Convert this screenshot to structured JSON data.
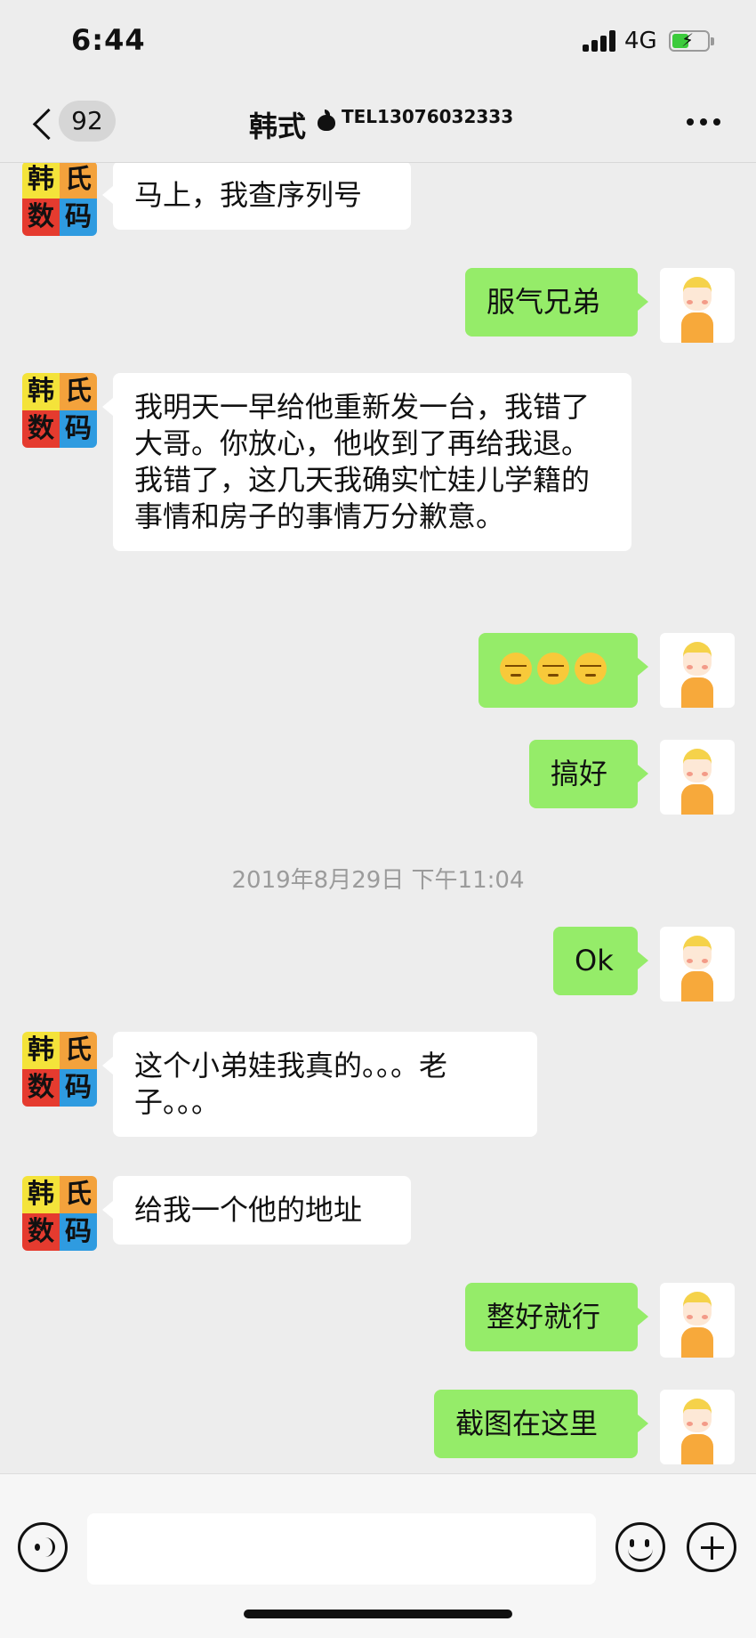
{
  "status_bar": {
    "time": "6:44",
    "network": "4G"
  },
  "nav": {
    "back_badge": "92",
    "title": "韩式",
    "subtitle": "TEL13076032333"
  },
  "shop_avatar": {
    "chars": [
      "韩",
      "氏",
      "数",
      "码"
    ]
  },
  "messages": [
    {
      "side": "in",
      "text": "马上，我查序列号"
    },
    {
      "side": "out",
      "text": "服气兄弟"
    },
    {
      "side": "in",
      "text": "我明天一早给他重新发一台，我错了大哥。你放心，他收到了再给我退。我错了，这几天我确实忙娃儿学籍的事情和房子的事情万分歉意。"
    },
    {
      "side": "out",
      "emoji": [
        "sweat-smile-icon",
        "sweat-smile-icon",
        "sweat-smile-icon"
      ]
    },
    {
      "side": "out",
      "text": "搞好"
    },
    {
      "side": "out",
      "text": "Ok"
    },
    {
      "side": "in",
      "text": "这个小弟娃我真的。。。老子。。。"
    },
    {
      "side": "in",
      "text": "给我一个他的地址"
    },
    {
      "side": "out",
      "text": "整好就行"
    },
    {
      "side": "out",
      "text": "截图在这里"
    }
  ],
  "timestamp": "2019年8月29日 下午11:04",
  "colors": {
    "outgoing_bubble": "#95ec69",
    "incoming_bubble": "#ffffff",
    "background": "#ededed"
  }
}
